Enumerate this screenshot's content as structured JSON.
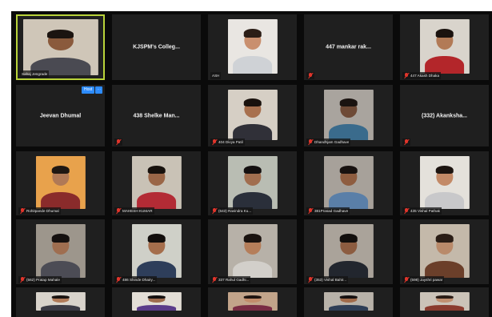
{
  "meeting": {
    "badge_label": "Host",
    "tiles": [
      {
        "kind": "video",
        "label": "Sahaj Jengrade",
        "muted": false,
        "active": true,
        "bg": "#cfc6b8",
        "skin": "#8a5a3c",
        "hair": "#1b1410",
        "shirt": "#4a4a52"
      },
      {
        "kind": "name",
        "name": "KJSPM's  Colleg...",
        "label": "",
        "muted": false
      },
      {
        "kind": "video",
        "label": "ASH",
        "muted": false,
        "bg": "#e9e6e2",
        "skin": "#c98f6e",
        "hair": "#2a1d16",
        "shirt": "#cfd2d6"
      },
      {
        "kind": "name",
        "name": "447  mankar  rak...",
        "label": "",
        "muted": true
      },
      {
        "kind": "video",
        "label": "447 Akash Dhaka",
        "muted": true,
        "bg": "#d9d4cc",
        "skin": "#b27a56",
        "hair": "#1a120e",
        "shirt": "#b3262a"
      },
      {
        "kind": "name",
        "name": "Jeevan Dhumal",
        "label": "",
        "muted": false
      },
      {
        "kind": "name",
        "name": "438  Shelke  Man...",
        "label": "",
        "muted": true
      },
      {
        "kind": "video",
        "label": "404 Divya Patil",
        "muted": true,
        "bg": "#d6cfc5",
        "skin": "#a8704e",
        "hair": "#19110d",
        "shirt": "#303038"
      },
      {
        "kind": "video",
        "label": "Dhandhjam Gadhave",
        "muted": true,
        "bg": "#a9a49e",
        "skin": "#6e4a36",
        "hair": "#1a1310",
        "shirt": "#3a6b8c"
      },
      {
        "kind": "name",
        "name": "(332)  Akanksha...",
        "label": "",
        "muted": true
      },
      {
        "kind": "video",
        "label": "Rohitpande Dhumal",
        "muted": true,
        "bg": "#e8a24c",
        "skin": "#b07956",
        "hair": "#1f1712",
        "shirt": "#8a2b2b"
      },
      {
        "kind": "video",
        "label": "MAHESH KUMAR",
        "muted": true,
        "bg": "#c9c2b6",
        "skin": "#9a6647",
        "hair": "#17110d",
        "shirt": "#b32b35"
      },
      {
        "kind": "video",
        "label": "(643) Ravindra Ku...",
        "muted": true,
        "bg": "#b9bdb3",
        "skin": "#a16e4f",
        "hair": "#141010",
        "shirt": "#2a2f3a"
      },
      {
        "kind": "video",
        "label": "381Prasad Gadhave",
        "muted": true,
        "bg": "#a7a19a",
        "skin": "#8e5d40",
        "hair": "#181210",
        "shirt": "#5a7fa8"
      },
      {
        "kind": "video",
        "label": "435 Vishal Pathak",
        "muted": true,
        "bg": "#e4e1db",
        "skin": "#c38a67",
        "hair": "#1c1410",
        "shirt": "#c8c8ca"
      },
      {
        "kind": "video",
        "label": "(562) Pratap Mahale",
        "muted": true,
        "bg": "#9d968c",
        "skin": "#9f6e50",
        "hair": "#161110",
        "shirt": "#4c4c55"
      },
      {
        "kind": "video",
        "label": "486 Shinde Dhairy...",
        "muted": true,
        "bg": "#cfd0c8",
        "skin": "#a56e4c",
        "hair": "#120e0c",
        "shirt": "#2e3e5a"
      },
      {
        "kind": "video",
        "label": "337 Rahul Gadhi...",
        "muted": true,
        "bg": "#b7b1a8",
        "skin": "#b57e5a",
        "hair": "#1a1310",
        "shirt": "#d2cfca"
      },
      {
        "kind": "video",
        "label": "(353) Vishal Bahir...",
        "muted": true,
        "bg": "#aaa39a",
        "skin": "#8c5c40",
        "hair": "#130f0d",
        "shirt": "#22262e"
      },
      {
        "kind": "video",
        "label": "(598) Jayshri pawar",
        "muted": true,
        "bg": "#c4b9aa",
        "skin": "#b98a6a",
        "hair": "#2a1d16",
        "shirt": "#6b3f2a"
      },
      {
        "kind": "video",
        "label": "",
        "muted": false,
        "bg": "#d8d3cb",
        "skin": "#b07a58",
        "hair": "#1a1310",
        "shirt": "#3a3a44"
      },
      {
        "kind": "video",
        "label": "",
        "muted": false,
        "bg": "#e3ded6",
        "skin": "#9f6c4e",
        "hair": "#141010",
        "shirt": "#5b3c8a"
      },
      {
        "kind": "video",
        "label": "",
        "muted": false,
        "bg": "#c2a48a",
        "skin": "#c28c6b",
        "hair": "#1f1410",
        "shirt": "#7a2c44"
      },
      {
        "kind": "video",
        "label": "",
        "muted": false,
        "bg": "#b8b2a9",
        "skin": "#a06a49",
        "hair": "#151010",
        "shirt": "#2e3e56"
      },
      {
        "kind": "video",
        "label": "",
        "muted": false,
        "bg": "#cbc3b8",
        "skin": "#c08f70",
        "hair": "#2a1c15",
        "shirt": "#8a3b2e"
      }
    ]
  }
}
